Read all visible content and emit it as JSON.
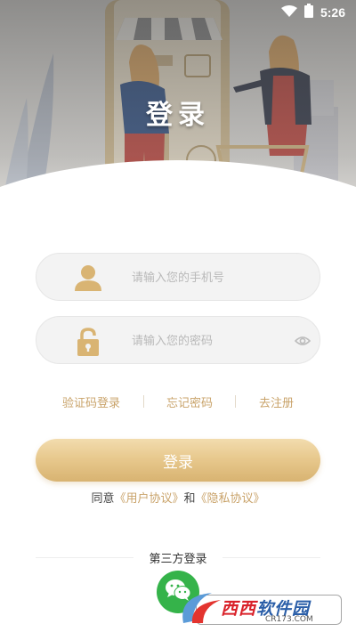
{
  "status_bar": {
    "time": "5:26",
    "icons": [
      "wifi-icon",
      "battery-icon"
    ]
  },
  "hero": {
    "title": "登录"
  },
  "phone_field": {
    "placeholder": "请输入您的手机号",
    "icon": "user-icon"
  },
  "password_field": {
    "placeholder": "请输入您的密码",
    "icon": "unlock-icon",
    "toggle_icon": "eye-icon"
  },
  "links": {
    "sms_login": "验证码登录",
    "forgot_password": "忘记密码",
    "register": "去注册"
  },
  "login_button": {
    "label": "登录"
  },
  "agreement": {
    "prefix": "同意",
    "user_agreement": "《用户协议》",
    "and": "和",
    "privacy_agreement": "《隐私协议》"
  },
  "third_party": {
    "label": "第三方登录",
    "wechat_icon": "wechat-icon"
  },
  "watermark": {
    "text_red": "西西",
    "text_blue": "软件园",
    "url": "CR173.COM"
  },
  "colors": {
    "accent_gold": "#c9a36a",
    "button_gold": "#e8c98e",
    "wechat_green": "#35b34a"
  }
}
